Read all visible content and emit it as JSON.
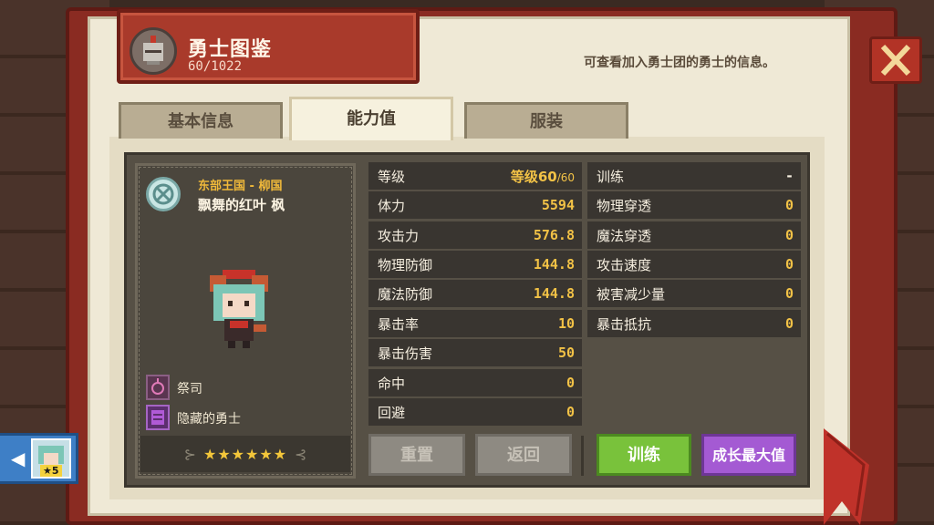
{
  "header": {
    "title": "勇士图鉴",
    "count": "60/1022",
    "description": "可查看加入勇士团的勇士的信息。"
  },
  "tabs": [
    {
      "label": "基本信息",
      "active": false
    },
    {
      "label": "能力值",
      "active": true
    },
    {
      "label": "服装",
      "active": false
    }
  ],
  "hero": {
    "region": "东部王国 - 柳国",
    "name": "飘舞的红叶 枫",
    "class": "祭司",
    "tag": "隐藏的勇士",
    "stars": "★★★★★★",
    "stars_deco_left": "⊱",
    "stars_deco_right": "⊰"
  },
  "stats_left": [
    {
      "label": "等级",
      "value": "等级60",
      "suffix": "/60"
    },
    {
      "label": "体力",
      "value": "5594"
    },
    {
      "label": "攻击力",
      "value": "576.8"
    },
    {
      "label": "物理防御",
      "value": "144.8"
    },
    {
      "label": "魔法防御",
      "value": "144.8"
    },
    {
      "label": "暴击率",
      "value": "10"
    },
    {
      "label": "暴击伤害",
      "value": "50"
    },
    {
      "label": "命中",
      "value": "0"
    },
    {
      "label": "回避",
      "value": "0"
    }
  ],
  "stats_right": [
    {
      "label": "训练",
      "value": "-"
    },
    {
      "label": "物理穿透",
      "value": "0"
    },
    {
      "label": "魔法穿透",
      "value": "0"
    },
    {
      "label": "攻击速度",
      "value": "0"
    },
    {
      "label": "被害减少量",
      "value": "0"
    },
    {
      "label": "暴击抵抗",
      "value": "0"
    }
  ],
  "buttons": {
    "reset": "重置",
    "back": "返回",
    "train": "训练",
    "max_growth": "成长最大值"
  },
  "side_tab": {
    "arrow": "◀",
    "badge": "★5"
  },
  "colors": {
    "accent_gold": "#f2c246",
    "header_red": "#a93a2b",
    "train_green": "#79c23b",
    "max_purple": "#a45ad3"
  }
}
